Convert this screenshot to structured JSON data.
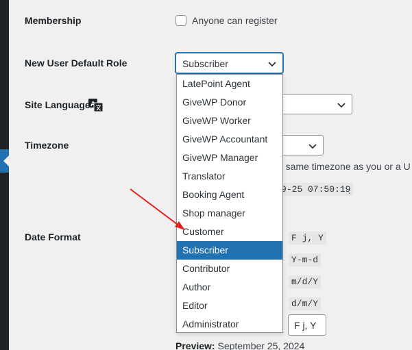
{
  "membership": {
    "label": "Membership",
    "checkbox_label": "Anyone can register",
    "checked": false
  },
  "default_role": {
    "label": "New User Default Role",
    "selected": "Subscriber",
    "options": [
      "LatePoint Agent",
      "GiveWP Donor",
      "GiveWP Worker",
      "GiveWP Accountant",
      "GiveWP Manager",
      "Translator",
      "Booking Agent",
      "Shop manager",
      "Customer",
      "Subscriber",
      "Contributor",
      "Author",
      "Editor",
      "Administrator"
    ]
  },
  "site_language": {
    "label": "Site Language",
    "icon": "translate-icon"
  },
  "timezone": {
    "label": "Timezone",
    "desc_partial": "e same timezone as you or a U",
    "time_partial": "9-25 07:50:19",
    "time_suffix": "."
  },
  "date_format": {
    "label": "Date Format",
    "formats": [
      "F j, Y",
      "Y-m-d",
      "m/d/Y",
      "d/m/Y"
    ],
    "custom_value": "F j, Y",
    "preview_label": "Preview:",
    "preview_value": "September 25, 2024"
  },
  "colors": {
    "accent": "#2271b1",
    "arrow": "#e3201b",
    "admin_bar": "#1d2327"
  }
}
